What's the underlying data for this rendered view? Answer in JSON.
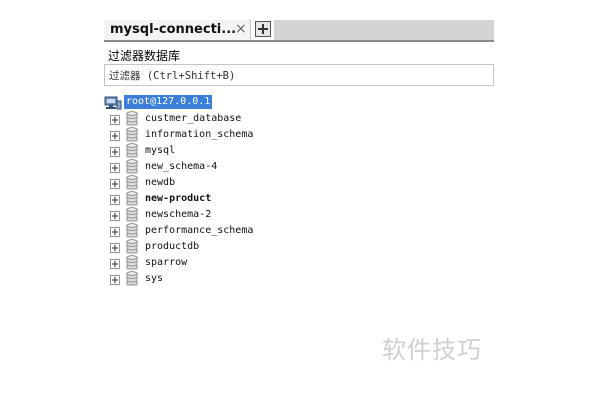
{
  "tab": {
    "title": "mysql-connecti...",
    "close_glyph": "×",
    "add_icon": "plus-icon"
  },
  "filter": {
    "label": "过滤器数据库",
    "placeholder": "过滤器 (Ctrl+Shift+B)"
  },
  "tree": {
    "root": {
      "icon": "server-icon",
      "label": "root@127.0.0.1",
      "selected": true,
      "highlight_color": "#3d7fd8"
    },
    "databases": [
      {
        "name": "custmer_database",
        "bold": false
      },
      {
        "name": "information_schema",
        "bold": false
      },
      {
        "name": "mysql",
        "bold": false
      },
      {
        "name": "new_schema-4",
        "bold": false
      },
      {
        "name": "newdb",
        "bold": false
      },
      {
        "name": "new-product",
        "bold": true
      },
      {
        "name": "newschema-2",
        "bold": false
      },
      {
        "name": "performance_schema",
        "bold": false
      },
      {
        "name": "productdb",
        "bold": false
      },
      {
        "name": "sparrow",
        "bold": false
      },
      {
        "name": "sys",
        "bold": false
      }
    ]
  },
  "watermark": "软件技巧"
}
